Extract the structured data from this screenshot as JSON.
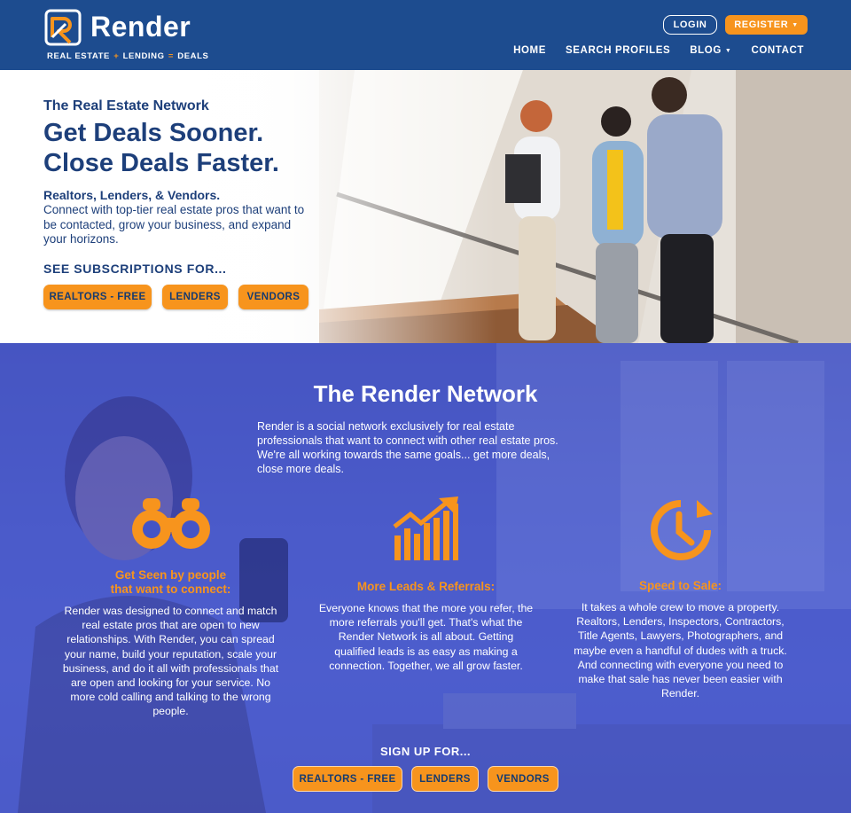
{
  "header": {
    "brand": "Render",
    "tagline_parts": [
      "REAL ESTATE",
      "+",
      "LENDING",
      "=",
      "DEALS"
    ],
    "login": "LOGIN",
    "register": "REGISTER",
    "nav": [
      {
        "label": "HOME"
      },
      {
        "label": "SEARCH PROFILES"
      },
      {
        "label": "BLOG"
      },
      {
        "label": "CONTACT"
      }
    ]
  },
  "hero": {
    "subtitle": "The Real Estate Network",
    "headline_1": "Get Deals Sooner.",
    "headline_2": "Close Deals Faster.",
    "strong": "Realtors, Lenders, & Vendors.",
    "body": "Connect with top-tier real estate pros that want to be contacted, grow your business, and expand your horizons.",
    "cta": "SEE SUBSCRIPTIONS FOR...",
    "buttons": [
      "REALTORS - FREE",
      "LENDERS",
      "VENDORS"
    ]
  },
  "network": {
    "title": "The Render Network",
    "intro": "Render is a social network exclusively for real estate professionals that want to connect with other real estate pros. We're all working towards the same goals... get more deals, close more deals.",
    "columns": [
      {
        "icon": "binoculars-icon",
        "title_1": "Get Seen by people",
        "title_2": "that want to connect:",
        "body": "Render was designed to connect and match real estate pros that are open to new relationships. With Render, you can spread your name, build your reputation, scale your business, and do it all with professionals that are open and looking for your service. No more cold calling and talking to the wrong people."
      },
      {
        "icon": "growth-chart-icon",
        "title_1": "More Leads & Referrals:",
        "body": "Everyone knows that the more you refer, the more referrals you'll get. That's what the Render Network is all about. Getting qualified leads is as easy as making a connection. Together, we all grow faster."
      },
      {
        "icon": "speed-clock-icon",
        "title_1": "Speed to Sale:",
        "body": "It takes a whole crew to move a property. Realtors, Lenders, Inspectors, Contractors, Title Agents, Lawyers, Photographers, and maybe even a handful of dudes with a truck. And connecting with everyone you need to make that sale has never been easier with Render."
      }
    ],
    "signup": "SIGN UP FOR...",
    "buttons": [
      "REALTORS - FREE",
      "LENDERS",
      "VENDORS"
    ]
  },
  "colors": {
    "header_blue": "#1d4c8f",
    "accent_orange": "#f7941d",
    "section_purple": "#4555c8",
    "navy_text": "#1d3f7a"
  }
}
